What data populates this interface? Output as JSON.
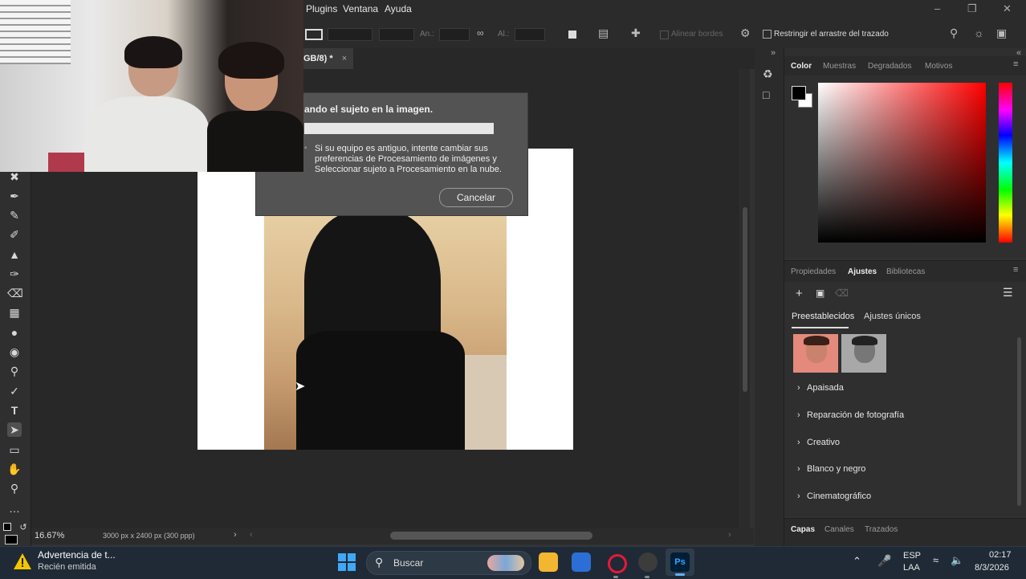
{
  "menubar": {
    "menus": [
      "Plugins",
      "Ventana",
      "Ayuda"
    ]
  },
  "optionsbar": {
    "width_label": "An.:",
    "height_label": "Al.:",
    "align_edges_label": "Alinear bordes",
    "constrain_label": "Restringir el arrastre del trazado"
  },
  "document": {
    "tab_label": "GB/8) *",
    "tab_close": "×"
  },
  "dialog": {
    "title": "ando el sujeto en la imagen.",
    "info": "Si su equipo es antiguo, intente cambiar sus preferencias de Procesamiento de imágenes y Seleccionar sujeto a Procesamiento en la nube.",
    "cancel_label": "Cancelar",
    "progress": 1.0
  },
  "status": {
    "zoom": "16.67%",
    "doc_info": "3000 px x 2400 px (300 ppp)"
  },
  "color_panel": {
    "tabs": [
      "Color",
      "Muestras",
      "Degradados",
      "Motivos"
    ],
    "active_tab": "Color",
    "foreground": "#000000",
    "background": "#ffffff",
    "hue_color": "#ff0000"
  },
  "adjust_panel": {
    "tabs": [
      "Propiedades",
      "Ajustes",
      "Bibliotecas"
    ],
    "active_tab": "Ajustes",
    "subtabs": [
      "Preestablecidos",
      "Ajustes únicos"
    ],
    "active_subtab": "Preestablecidos",
    "groups": [
      "Apaisada",
      "Reparación de fotografía",
      "Creativo",
      "Blanco y negro",
      "Cinematográfico"
    ]
  },
  "layers_panel": {
    "tabs": [
      "Capas",
      "Canales",
      "Trazados"
    ],
    "active_tab": "Capas"
  },
  "taskbar": {
    "notification_title": "Advertencia de t...",
    "notification_subtitle": "Recién emitida",
    "search_label": "Buscar",
    "active_app_label": "Ps",
    "language_top": "ESP",
    "language_bottom": "LAA",
    "time": "02:17",
    "date": "8/3/2026"
  },
  "icons": {
    "window_controls": [
      "minimize-icon",
      "restore-icon",
      "close-icon"
    ],
    "tools": [
      "move-icon",
      "eyedropper-icon",
      "healing-brush-icon",
      "brush-icon",
      "stamp-icon",
      "history-brush-icon",
      "eraser-icon",
      "gradient-icon",
      "blur-icon",
      "dodge-icon",
      "smudge-icon",
      "pen-icon",
      "type-icon",
      "path-select-icon",
      "rectangle-icon",
      "hand-icon",
      "zoom-icon",
      "more-icon"
    ]
  }
}
